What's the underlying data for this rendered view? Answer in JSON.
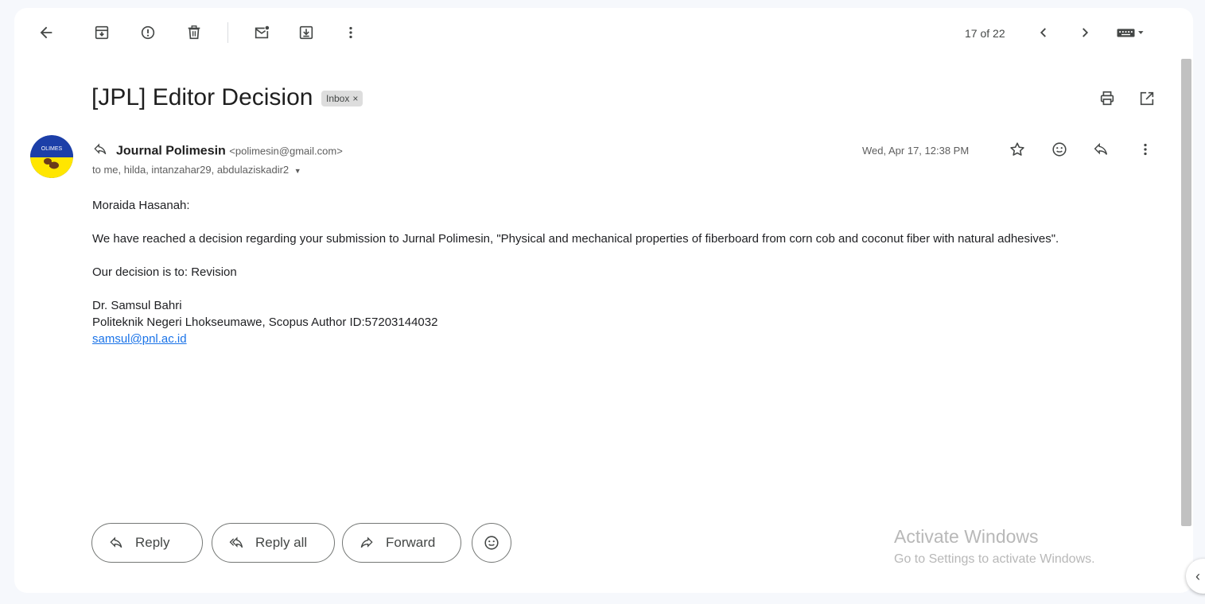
{
  "toolbar": {
    "back_icon": "arrow-left-icon",
    "archive_icon": "archive-icon",
    "spam_icon": "report-spam-icon",
    "delete_icon": "trash-icon",
    "mark_unread_icon": "mark-unread-icon",
    "move_icon": "move-to-icon",
    "more_icon": "more-vert-icon",
    "pager": "17 of 22",
    "prev_icon": "chevron-left-icon",
    "next_icon": "chevron-right-icon",
    "input_tools_icon": "keyboard-icon"
  },
  "email": {
    "subject": "[JPL] Editor Decision",
    "label": "Inbox",
    "label_remove": "×",
    "sender_name": "Journal Polimesin",
    "sender_email": "<polimesin@gmail.com>",
    "recipients": "to me, hilda, intanzahar29, abdulaziskadir2",
    "date": "Wed, Apr 17, 12:38 PM",
    "avatar_text": "OLIMES",
    "body": {
      "greeting": "Moraida Hasanah:",
      "para1": "We have reached a decision regarding your submission to Jurnal Polimesin, \"Physical and mechanical properties of fiberboard from corn cob and coconut fiber with natural adhesives\".",
      "decision": "Our decision is to: Revision",
      "sig_name": "Dr. Samsul Bahri",
      "sig_affiliation": "Politeknik Negeri Lhokseumawe, Scopus Author ID:57203144032",
      "sig_email": "samsul@pnl.ac.id"
    }
  },
  "actions": {
    "reply": "Reply",
    "reply_all": "Reply all",
    "forward": "Forward"
  },
  "watermark": {
    "title": "Activate Windows",
    "subtitle": "Go to Settings to activate Windows."
  },
  "side_toggle": "‹"
}
